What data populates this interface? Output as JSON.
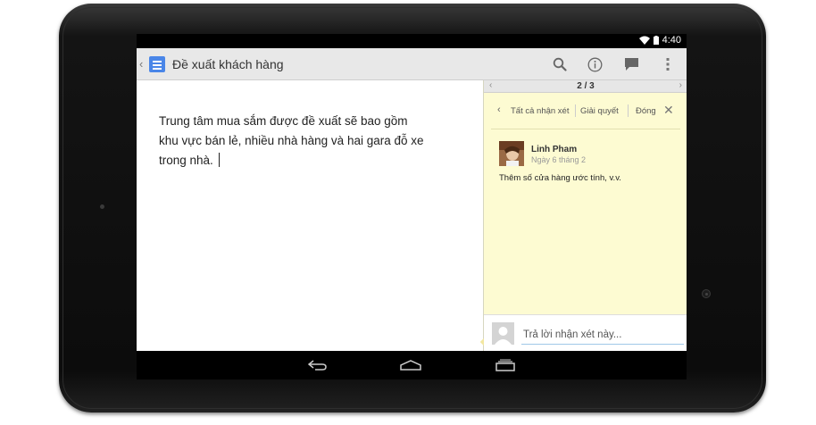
{
  "statusbar": {
    "time": "4:40"
  },
  "appbar": {
    "title": "Đề xuất khách hàng",
    "icons": [
      "chevron-left-icon",
      "docs-icon",
      "search-icon",
      "info-icon",
      "comment-icon",
      "overflow-menu-icon"
    ]
  },
  "document": {
    "text": "Trung tâm mua sắm được đề xuất sẽ bao gồm khu vực bán lẻ, nhiều nhà hàng và hai gara đỗ xe trong nhà."
  },
  "comments": {
    "pager": {
      "count": "2 / 3"
    },
    "actions": {
      "all_comments": "Tất cả nhận xét",
      "resolve": "Giải quyết",
      "close": "Đóng"
    },
    "items": [
      {
        "author": "Linh Pham",
        "date": "Ngày 6 tháng 2",
        "body": "Thêm số cửa hàng ước tính, v.v."
      }
    ],
    "reply_placeholder": "Trả lời nhận xét này..."
  },
  "colors": {
    "docs_blue": "#4a86e8",
    "comment_bg": "#fdfbd2",
    "appbar_bg": "#e8e8e8"
  }
}
